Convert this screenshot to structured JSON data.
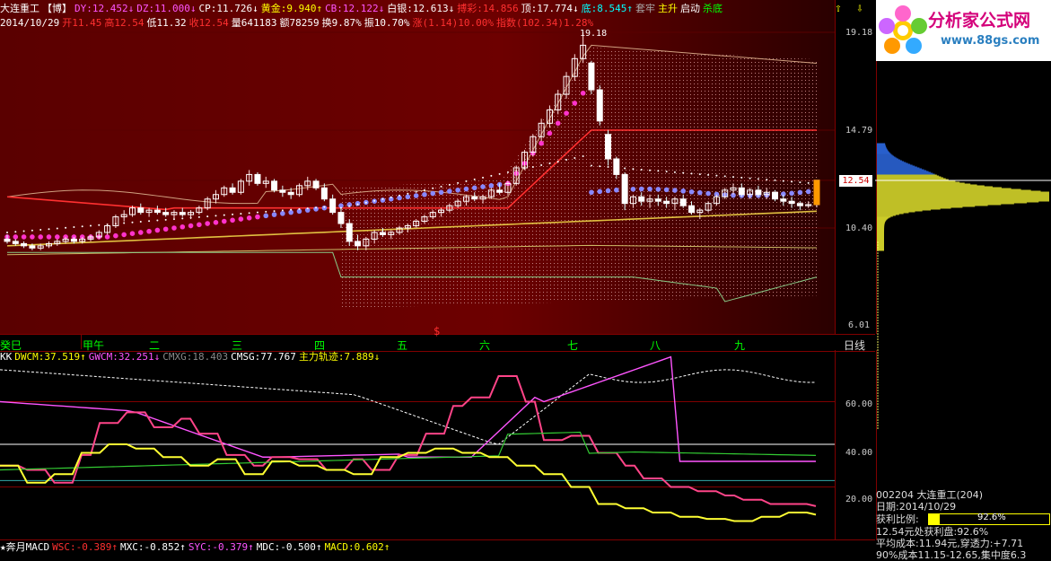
{
  "colors": {
    "up": "#ff3030",
    "down": "#00ffff",
    "bg_top": "#8b0000",
    "magenta": "#ff33cc",
    "yellow": "#ffff33",
    "blue": "#7777ff",
    "white": "#ffffff",
    "green": "#33cc33",
    "grid": "#800000"
  },
  "header": {
    "line1": [
      {
        "t": "大连重工",
        "c": "#ffffff"
      },
      {
        "t": "【博】",
        "c": "#ffffff"
      },
      {
        "t": "DY:12.452↓",
        "c": "#ff55ff"
      },
      {
        "t": "DZ:11.000↓",
        "c": "#ff55ff"
      },
      {
        "t": "CP:11.726↓",
        "c": "#ffffff"
      },
      {
        "t": "黄金:9.940↑",
        "c": "#ffff00"
      },
      {
        "t": "CB:12.122↓",
        "c": "#ff55ff"
      },
      {
        "t": "白银:12.613↓",
        "c": "#ffffff"
      },
      {
        "t": "搏彩:14.856",
        "c": "#ff3030"
      },
      {
        "t": "顶:17.774↓",
        "c": "#ffffff"
      },
      {
        "t": "底:8.545↑",
        "c": "#00ffff"
      },
      {
        "t": "套牢",
        "c": "#aaaaaa"
      },
      {
        "t": "主升",
        "c": "#ffff00"
      },
      {
        "t": "启动",
        "c": "#ffffff"
      },
      {
        "t": "杀底",
        "c": "#00ff00"
      }
    ],
    "line2": [
      {
        "t": "2014/10/29",
        "c": "#ffffff"
      },
      {
        "t": "开11.45",
        "c": "#ff3030"
      },
      {
        "t": "高12.54",
        "c": "#ff3030"
      },
      {
        "t": "低11.32",
        "c": "#ffffff"
      },
      {
        "t": "收12.54",
        "c": "#ff3030"
      },
      {
        "t": "量641183",
        "c": "#ffffff"
      },
      {
        "t": "额78259",
        "c": "#ffffff"
      },
      {
        "t": "换9.87%",
        "c": "#ffffff"
      },
      {
        "t": "振10.70%",
        "c": "#ffffff"
      },
      {
        "t": "涨(1.14)10.00%",
        "c": "#ff3030"
      },
      {
        "t": "指数(102.34)1.28%",
        "c": "#ff3030"
      }
    ],
    "high_mark": "19.18"
  },
  "price_axis": [
    "19.18",
    "14.79",
    "12.54",
    "10.40",
    "6.01"
  ],
  "current_price": "12.54",
  "x_labels": [
    "癸巳",
    "甲午",
    "二",
    "三",
    "四",
    "五",
    "六",
    "七",
    "八",
    "九"
  ],
  "period": "日线",
  "dollar_mark": "$",
  "indicator1": {
    "items": [
      {
        "t": "KK",
        "c": "#ffffff"
      },
      {
        "t": "DWCM:37.519↑",
        "c": "#ffff00"
      },
      {
        "t": "GWCM:32.251↓",
        "c": "#ff55ff"
      },
      {
        "t": "CMXG:18.403",
        "c": "#888888"
      },
      {
        "t": "CMSG:77.767",
        "c": "#ffffff"
      },
      {
        "t": "主力轨迹:7.889↓",
        "c": "#ffff00"
      }
    ],
    "axis": [
      "60.00",
      "40.00",
      "20.00"
    ]
  },
  "indicator2": {
    "items": [
      {
        "t": "★奔月MACD",
        "c": "#ffffff"
      },
      {
        "t": "WSC:-0.389↑",
        "c": "#ff3030"
      },
      {
        "t": "MXC:-0.852↑",
        "c": "#ffffff"
      },
      {
        "t": "SYC:-0.379↑",
        "c": "#ff55ff"
      },
      {
        "t": "MDC:-0.500↑",
        "c": "#ffffff"
      },
      {
        "t": "MACD:0.602↑",
        "c": "#ffff00"
      }
    ]
  },
  "logo": {
    "title": "分析家公式网",
    "url": "www.88gs.com"
  },
  "chip_info": {
    "code_line": "002204 大连重工(204)",
    "date_line": "日期:2014/10/29",
    "profit_label": "获利比例:",
    "profit_value": "92.6%",
    "profit_line": "12.54元处获利盘:92.6%",
    "cost_line": "平均成本:11.94元,穿透力:+7.71",
    "range_line": "90%成本11.15-12.65,集中度6.3"
  },
  "chart_data": {
    "type": "candlestick",
    "ylim": [
      6.01,
      19.18
    ],
    "ticks": [
      19.18,
      14.79,
      12.54,
      10.4,
      6.01
    ],
    "ohlc": [
      [
        9.9,
        10.1,
        9.7,
        9.8
      ],
      [
        9.8,
        9.9,
        9.6,
        9.7
      ],
      [
        9.7,
        9.8,
        9.5,
        9.6
      ],
      [
        9.6,
        9.7,
        9.4,
        9.5
      ],
      [
        9.5,
        9.7,
        9.4,
        9.6
      ],
      [
        9.6,
        9.8,
        9.5,
        9.7
      ],
      [
        9.7,
        9.9,
        9.6,
        9.8
      ],
      [
        9.8,
        10.0,
        9.7,
        9.9
      ],
      [
        9.9,
        10.0,
        9.7,
        9.8
      ],
      [
        9.8,
        10.0,
        9.7,
        9.9
      ],
      [
        9.9,
        10.1,
        9.8,
        10.0
      ],
      [
        10.0,
        10.3,
        9.9,
        10.2
      ],
      [
        10.2,
        10.6,
        10.1,
        10.5
      ],
      [
        10.5,
        11.0,
        10.4,
        10.9
      ],
      [
        10.9,
        11.2,
        10.7,
        11.0
      ],
      [
        11.0,
        11.4,
        10.9,
        11.3
      ],
      [
        11.3,
        11.5,
        11.0,
        11.1
      ],
      [
        11.1,
        11.3,
        10.9,
        11.2
      ],
      [
        11.2,
        11.4,
        11.0,
        11.1
      ],
      [
        11.1,
        11.3,
        10.9,
        11.0
      ],
      [
        11.0,
        11.2,
        10.8,
        11.1
      ],
      [
        11.1,
        11.3,
        10.9,
        11.0
      ],
      [
        11.0,
        11.2,
        10.8,
        11.1
      ],
      [
        11.1,
        11.4,
        11.0,
        11.3
      ],
      [
        11.3,
        11.8,
        11.2,
        11.7
      ],
      [
        11.7,
        12.1,
        11.5,
        11.9
      ],
      [
        11.9,
        12.3,
        11.8,
        12.2
      ],
      [
        12.2,
        12.4,
        11.9,
        12.0
      ],
      [
        12.0,
        12.6,
        11.9,
        12.5
      ],
      [
        12.5,
        13.0,
        12.3,
        12.8
      ],
      [
        12.8,
        12.9,
        12.3,
        12.4
      ],
      [
        12.4,
        12.7,
        12.2,
        12.5
      ],
      [
        12.5,
        12.6,
        12.0,
        12.1
      ],
      [
        12.1,
        12.3,
        11.8,
        12.0
      ],
      [
        12.0,
        12.2,
        11.7,
        11.9
      ],
      [
        11.9,
        12.4,
        11.8,
        12.3
      ],
      [
        12.3,
        12.7,
        12.1,
        12.5
      ],
      [
        12.5,
        12.6,
        12.1,
        12.2
      ],
      [
        12.2,
        12.4,
        11.6,
        11.7
      ],
      [
        11.7,
        11.9,
        11.0,
        11.1
      ],
      [
        11.1,
        11.3,
        10.4,
        10.6
      ],
      [
        10.6,
        10.8,
        9.6,
        9.8
      ],
      [
        9.8,
        10.1,
        9.4,
        9.6
      ],
      [
        9.6,
        10.0,
        9.4,
        9.9
      ],
      [
        9.9,
        10.3,
        9.7,
        10.2
      ],
      [
        10.2,
        10.4,
        10.0,
        10.1
      ],
      [
        10.1,
        10.3,
        9.9,
        10.2
      ],
      [
        10.2,
        10.5,
        10.1,
        10.4
      ],
      [
        10.4,
        10.6,
        10.2,
        10.5
      ],
      [
        10.5,
        10.8,
        10.4,
        10.7
      ],
      [
        10.7,
        11.0,
        10.6,
        10.9
      ],
      [
        10.9,
        11.2,
        10.8,
        11.1
      ],
      [
        11.1,
        11.3,
        10.9,
        11.2
      ],
      [
        11.2,
        11.5,
        11.1,
        11.4
      ],
      [
        11.4,
        11.7,
        11.3,
        11.6
      ],
      [
        11.6,
        11.9,
        11.4,
        11.8
      ],
      [
        11.8,
        12.0,
        11.6,
        11.7
      ],
      [
        11.7,
        11.9,
        11.5,
        11.8
      ],
      [
        11.8,
        12.2,
        11.7,
        12.1
      ],
      [
        12.1,
        12.4,
        11.9,
        12.0
      ],
      [
        12.0,
        12.5,
        11.9,
        12.4
      ],
      [
        12.4,
        13.2,
        12.3,
        13.1
      ],
      [
        13.1,
        13.9,
        13.0,
        13.8
      ],
      [
        13.8,
        14.6,
        13.6,
        14.5
      ],
      [
        14.5,
        15.3,
        14.3,
        15.1
      ],
      [
        15.1,
        15.9,
        14.9,
        15.7
      ],
      [
        15.7,
        16.6,
        15.5,
        16.4
      ],
      [
        16.4,
        17.4,
        16.2,
        17.2
      ],
      [
        17.2,
        18.2,
        17.0,
        18.0
      ],
      [
        18.0,
        19.18,
        17.8,
        18.6
      ],
      [
        17.8,
        17.9,
        16.4,
        16.6
      ],
      [
        16.6,
        16.8,
        15.0,
        15.2
      ],
      [
        14.6,
        14.8,
        13.2,
        13.5
      ],
      [
        13.5,
        13.6,
        12.6,
        12.8
      ],
      [
        12.8,
        12.9,
        11.2,
        11.5
      ],
      [
        11.5,
        11.9,
        11.3,
        11.8
      ],
      [
        11.8,
        12.0,
        11.4,
        11.6
      ],
      [
        11.6,
        11.9,
        11.3,
        11.7
      ],
      [
        11.7,
        11.9,
        11.4,
        11.6
      ],
      [
        11.6,
        11.8,
        11.3,
        11.5
      ],
      [
        11.5,
        11.8,
        11.2,
        11.7
      ],
      [
        11.7,
        11.9,
        11.3,
        11.4
      ],
      [
        11.4,
        11.6,
        11.0,
        11.1
      ],
      [
        11.1,
        11.3,
        10.8,
        11.2
      ],
      [
        11.2,
        11.6,
        11.1,
        11.5
      ],
      [
        11.5,
        11.9,
        11.4,
        11.8
      ],
      [
        11.8,
        12.2,
        11.7,
        12.1
      ],
      [
        12.1,
        12.4,
        11.9,
        12.2
      ],
      [
        12.2,
        12.4,
        11.8,
        11.9
      ],
      [
        11.9,
        12.2,
        11.7,
        12.1
      ],
      [
        12.1,
        12.3,
        11.8,
        11.9
      ],
      [
        11.9,
        12.2,
        11.7,
        12.0
      ],
      [
        12.0,
        12.1,
        11.6,
        11.7
      ],
      [
        11.7,
        11.9,
        11.4,
        11.6
      ],
      [
        11.6,
        11.8,
        11.3,
        11.5
      ],
      [
        11.5,
        11.6,
        11.2,
        11.4
      ],
      [
        11.4,
        11.6,
        11.3,
        11.45
      ],
      [
        11.45,
        12.54,
        11.32,
        12.54
      ]
    ]
  }
}
